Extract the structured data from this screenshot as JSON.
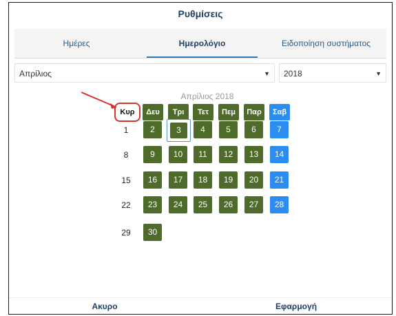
{
  "dialog": {
    "title": "Ρυθμίσεις"
  },
  "tabs": [
    {
      "label": "Ημέρες",
      "active": false
    },
    {
      "label": "Ημερολόγιο",
      "active": true
    },
    {
      "label": "Ειδοποίηση συστήματος",
      "active": false
    }
  ],
  "month_select": {
    "value": "Απρίλιος"
  },
  "year_select": {
    "value": "2018"
  },
  "calendar": {
    "title": "Απρίλιος 2018",
    "weekdays": [
      "Κυρ",
      "Δευ",
      "Τρι",
      "Τετ",
      "Πεμ",
      "Παρ",
      "Σαβ"
    ],
    "highlighted_weekday": "Κυρ",
    "selected_day": "3",
    "weeks": [
      {
        "label": "1",
        "days": [
          "2",
          "3",
          "4",
          "5",
          "6",
          "7"
        ]
      },
      {
        "label": "8",
        "days": [
          "9",
          "10",
          "11",
          "12",
          "13",
          "14"
        ]
      },
      {
        "label": "15",
        "days": [
          "16",
          "17",
          "18",
          "19",
          "20",
          "21"
        ]
      },
      {
        "label": "22",
        "days": [
          "23",
          "24",
          "25",
          "26",
          "27",
          "28"
        ]
      },
      {
        "label": "29",
        "days": [
          "30"
        ]
      }
    ]
  },
  "footer": {
    "cancel_label": "Ακυρο",
    "apply_label": "Εφαρμογή"
  },
  "colors": {
    "weekday": "#4f6b2b",
    "saturday": "#2d8cef",
    "annotation": "#d9322b",
    "title": "#1f3f64"
  }
}
